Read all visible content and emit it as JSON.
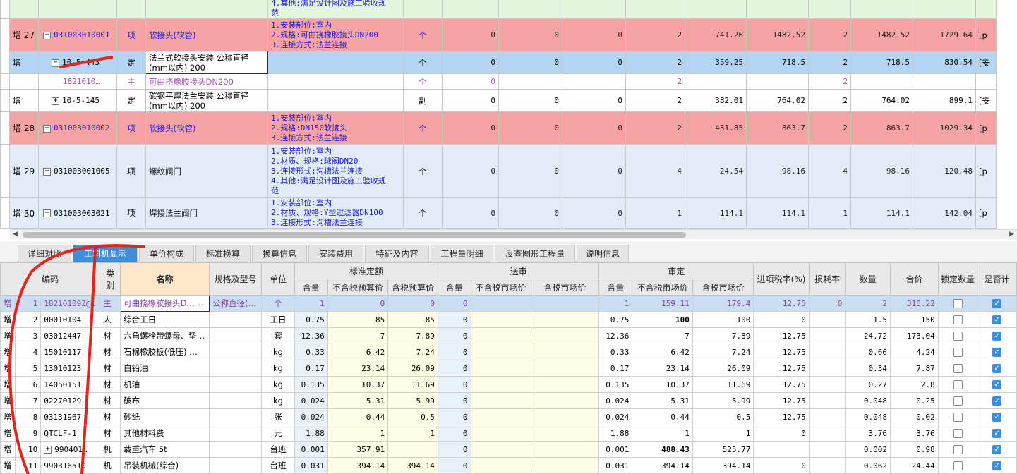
{
  "upper_rows": [
    {
      "style": "green",
      "zeng": "",
      "idx": "",
      "code": "",
      "type": "",
      "name": "",
      "features": [
        "4.其他:满足设计图及施工验收规",
        "范"
      ],
      "unit": "",
      "v": [
        "",
        "",
        "",
        "",
        "",
        "",
        "",
        "",
        ""
      ],
      "tail": ""
    },
    {
      "style": "red",
      "zeng": "增",
      "idx": "27",
      "expander": "−",
      "code": "031003010001",
      "type": "项",
      "name": "软接头(软管)",
      "features": [
        "1.安装部位:室内",
        "2.规格:可曲挠橡胶接头DN200",
        "3.连接方式:法兰连接"
      ],
      "unit": "个",
      "v": [
        "0",
        "0",
        "0",
        "2",
        "741.26",
        "1482.52",
        "2",
        "1482.52",
        "1729.64"
      ],
      "tail": "[p"
    },
    {
      "style": "sel",
      "zeng": "增",
      "idx": "",
      "expander": "−",
      "code": "10-5-443",
      "type": "定",
      "name": "法兰式软接头安装 公称直径(mm以内) 200",
      "features": [],
      "unit": "个",
      "v": [
        "0",
        "0",
        "0",
        "2",
        "359.25",
        "718.5",
        "2",
        "718.5",
        "830.54"
      ],
      "tail": "[安"
    },
    {
      "style": "main",
      "zeng": "",
      "idx": "",
      "expander": "",
      "code": "1821010…",
      "type": "主",
      "name": "可曲挠橡胶接头DN200",
      "features": [],
      "unit": "个",
      "v": [
        "0",
        "",
        "",
        "2",
        "",
        "",
        "2",
        "",
        ""
      ],
      "tail": ""
    },
    {
      "style": "plain",
      "zeng": "增",
      "idx": "",
      "expander": "+",
      "code": "10-5-145",
      "type": "定",
      "name": "碳钢平焊法兰安装 公称直径(mm以内) 200",
      "features": [],
      "unit": "副",
      "v": [
        "0",
        "0",
        "0",
        "2",
        "382.01",
        "764.02",
        "2",
        "764.02",
        "899.1"
      ],
      "tail": "[安"
    },
    {
      "style": "red",
      "zeng": "增",
      "idx": "28",
      "expander": "+",
      "code": "031003010002",
      "type": "项",
      "name": "软接头(软管)",
      "features": [
        "1.安装部位:室内",
        "2.规格:DN150软接头",
        "3.连接方式:法兰连接"
      ],
      "unit": "个",
      "v": [
        "0",
        "0",
        "0",
        "2",
        "431.85",
        "863.7",
        "2",
        "863.7",
        "1029.34"
      ],
      "tail": "[p"
    },
    {
      "style": "blue",
      "zeng": "增",
      "idx": "29",
      "expander": "+",
      "code": "031003001005",
      "type": "项",
      "name": "螺纹阀门",
      "features": [
        "1.安装部位:室内",
        "2.材质、规格:球阀DN20",
        "3.连接形式:沟槽法兰连接",
        "4.其他:满足设计图及施工验收规",
        "范"
      ],
      "unit": "个",
      "v": [
        "0",
        "0",
        "0",
        "4",
        "24.54",
        "98.16",
        "4",
        "98.16",
        "120.48"
      ],
      "tail": "[p"
    },
    {
      "style": "blue",
      "zeng": "增",
      "idx": "30",
      "expander": "+",
      "code": "031003003021",
      "type": "项",
      "name": "焊接法兰阀门",
      "features": [
        "1.安装部位:室内",
        "2.材质、规格:Y型过滤器DN100",
        "3.连接形式:沟槽法兰连接"
      ],
      "unit": "个",
      "v": [
        "0",
        "0",
        "0",
        "1",
        "114.1",
        "114.1",
        "1",
        "114.1",
        "142.04"
      ],
      "tail": "[p"
    }
  ],
  "tabs": [
    "详细对比",
    "工料机显示",
    "单价构成",
    "标准换算",
    "换算信息",
    "安装费用",
    "特征及内容",
    "工程量明细",
    "反查图形工程量",
    "说明信息"
  ],
  "active_tab": 1,
  "lower_headers": {
    "code": "编码",
    "type": "类别",
    "name": "名称",
    "spec": "规格及型号",
    "unit": "单位",
    "grp_std": "标准定额",
    "grp_send": "送审",
    "grp_audit": "审定",
    "qty": "含量",
    "ex_budget": "不含税预算价",
    "in_budget": "含税预算价",
    "ex_market": "不含税市场价",
    "in_market": "含税市场价",
    "tax": "进项税率(%)",
    "loss": "损耗率",
    "amount": "数量",
    "total": "合价",
    "lock": "锁定数量",
    "calc": "是否计"
  },
  "lower_rows": [
    {
      "sel": true,
      "zeng": "增",
      "idx": "1",
      "code": "18210109Z@1",
      "type": "主",
      "name": "可曲挠橡胶接头D…",
      "dots": "…",
      "spec": "公称直径(…",
      "unit": "个",
      "q1": "1",
      "b1": "0",
      "b2": "0",
      "q2": "0",
      "s1": "",
      "s2": "",
      "q3": "1",
      "m1": "159.11",
      "m2": "179.4",
      "tax": "12.75",
      "loss": "0",
      "amt": "2",
      "tot": "318.22",
      "bold": false
    },
    {
      "zeng": "增",
      "idx": "2",
      "code": "00010104",
      "type": "人",
      "name": "综合工日",
      "spec": "",
      "unit": "工日",
      "q1": "0.75",
      "b1": "85",
      "b2": "85",
      "q2": "0",
      "s1": "",
      "s2": "",
      "q3": "0.75",
      "m1": "100",
      "m2": "100",
      "tax": "0",
      "loss": "",
      "amt": "1.5",
      "tot": "150",
      "bold": true
    },
    {
      "zeng": "增",
      "idx": "3",
      "code": "03012447",
      "type": "材",
      "name": "六角螺栓带螺母、垫…",
      "spec": "",
      "unit": "套",
      "q1": "12.36",
      "b1": "7",
      "b2": "7.89",
      "q2": "0",
      "s1": "",
      "s2": "",
      "q3": "12.36",
      "m1": "7",
      "m2": "7.89",
      "tax": "12.75",
      "loss": "",
      "amt": "24.72",
      "tot": "173.04",
      "bold": false
    },
    {
      "zeng": "增",
      "idx": "4",
      "code": "15010117",
      "type": "材",
      "name": "石棉橡胶板(低压) …",
      "spec": "",
      "unit": "kg",
      "q1": "0.33",
      "b1": "6.42",
      "b2": "7.24",
      "q2": "0",
      "s1": "",
      "s2": "",
      "q3": "0.33",
      "m1": "6.42",
      "m2": "7.24",
      "tax": "12.75",
      "loss": "",
      "amt": "0.66",
      "tot": "4.24",
      "bold": false
    },
    {
      "zeng": "增",
      "idx": "5",
      "code": "13010123",
      "type": "材",
      "name": "白铅油",
      "spec": "",
      "unit": "kg",
      "q1": "0.17",
      "b1": "23.14",
      "b2": "26.09",
      "q2": "0",
      "s1": "",
      "s2": "",
      "q3": "0.17",
      "m1": "23.14",
      "m2": "26.09",
      "tax": "12.75",
      "loss": "",
      "amt": "0.34",
      "tot": "7.87",
      "bold": false
    },
    {
      "zeng": "增",
      "idx": "6",
      "code": "14050151",
      "type": "材",
      "name": "机油",
      "spec": "",
      "unit": "kg",
      "q1": "0.135",
      "b1": "10.37",
      "b2": "11.69",
      "q2": "0",
      "s1": "",
      "s2": "",
      "q3": "0.135",
      "m1": "10.37",
      "m2": "11.69",
      "tax": "12.75",
      "loss": "",
      "amt": "0.27",
      "tot": "2.8",
      "bold": false
    },
    {
      "zeng": "增",
      "idx": "7",
      "code": "02270129",
      "type": "材",
      "name": "破布",
      "spec": "",
      "unit": "kg",
      "q1": "0.024",
      "b1": "5.31",
      "b2": "5.99",
      "q2": "0",
      "s1": "",
      "s2": "",
      "q3": "0.024",
      "m1": "5.31",
      "m2": "5.99",
      "tax": "12.75",
      "loss": "",
      "amt": "0.048",
      "tot": "0.25",
      "bold": false
    },
    {
      "zeng": "增",
      "idx": "8",
      "code": "03131967",
      "type": "材",
      "name": "砂纸",
      "spec": "",
      "unit": "张",
      "q1": "0.024",
      "b1": "0.44",
      "b2": "0.5",
      "q2": "0",
      "s1": "",
      "s2": "",
      "q3": "0.024",
      "m1": "0.44",
      "m2": "0.5",
      "tax": "12.75",
      "loss": "",
      "amt": "0.048",
      "tot": "0.02",
      "bold": false
    },
    {
      "zeng": "增",
      "idx": "9",
      "code": "QTCLF-1",
      "type": "材",
      "name": "其他材料费",
      "spec": "",
      "unit": "元",
      "q1": "1.88",
      "b1": "1",
      "b2": "1",
      "q2": "0",
      "s1": "",
      "s2": "",
      "q3": "1.88",
      "m1": "1",
      "m2": "1",
      "tax": "0",
      "loss": "",
      "amt": "3.76",
      "tot": "3.76",
      "bold": false
    },
    {
      "zeng": "增",
      "idx": "10",
      "exp": "+",
      "code": "990401…",
      "type": "机",
      "name": "载重汽车 5t",
      "spec": "",
      "unit": "台班",
      "q1": "0.001",
      "b1": "357.91",
      "b2": "",
      "q2": "0",
      "s1": "",
      "s2": "",
      "q3": "0.001",
      "m1": "488.43",
      "m2": "525.77",
      "tax": "",
      "loss": "",
      "amt": "0.002",
      "tot": "0.98",
      "bold": true
    },
    {
      "zeng": "增",
      "idx": "11",
      "code": "990316510",
      "type": "机",
      "name": "吊装机械(综合)",
      "spec": "",
      "unit": "台班",
      "q1": "0.031",
      "b1": "394.14",
      "b2": "394.14",
      "q2": "0",
      "s1": "",
      "s2": "",
      "q3": "0.031",
      "m1": "394.14",
      "m2": "394.14",
      "tax": "0",
      "loss": "",
      "amt": "0.062",
      "tot": "24.44",
      "bold": false
    }
  ]
}
